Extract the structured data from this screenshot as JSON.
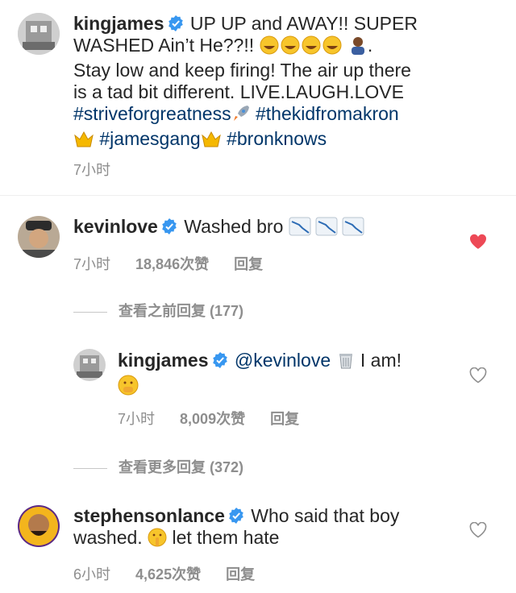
{
  "caption": {
    "username": "kingjames",
    "text_1": "UP UP and AWAY!! SUPER",
    "text_2": "WASHED Ain’t He??!!",
    "text_3": "Stay low and keep firing! The air up there",
    "text_4": "is a tad bit different. LIVE.LAUGH.LOVE",
    "hashtags": [
      "#striveforgreatness",
      "#thekidfromakron",
      "#jamesgang",
      "#bronknows"
    ],
    "time": "7小时"
  },
  "comment1": {
    "username": "kevinlove",
    "text": "Washed bro",
    "time": "7小时",
    "likes": "18,846次赞",
    "reply_label": "回复",
    "liked": true
  },
  "view_prev": "查看之前回复 (177)",
  "reply1": {
    "username": "kingjames",
    "mention": "@kevinlove",
    "text": "I am!",
    "time": "7小时",
    "likes": "8,009次赞",
    "reply_label": "回复"
  },
  "view_more": "查看更多回复 (372)",
  "comment2": {
    "username": "stephensonlance",
    "text_1": "Who said that boy",
    "text_2": "washed.",
    "text_3": "let them hate",
    "time": "6小时",
    "likes": "4,625次赞",
    "reply_label": "回复"
  },
  "colors": {
    "hashtag": "#003569",
    "meta": "#8e8e8e",
    "heart_liked": "#ed4956",
    "verified": "#3897f0"
  }
}
